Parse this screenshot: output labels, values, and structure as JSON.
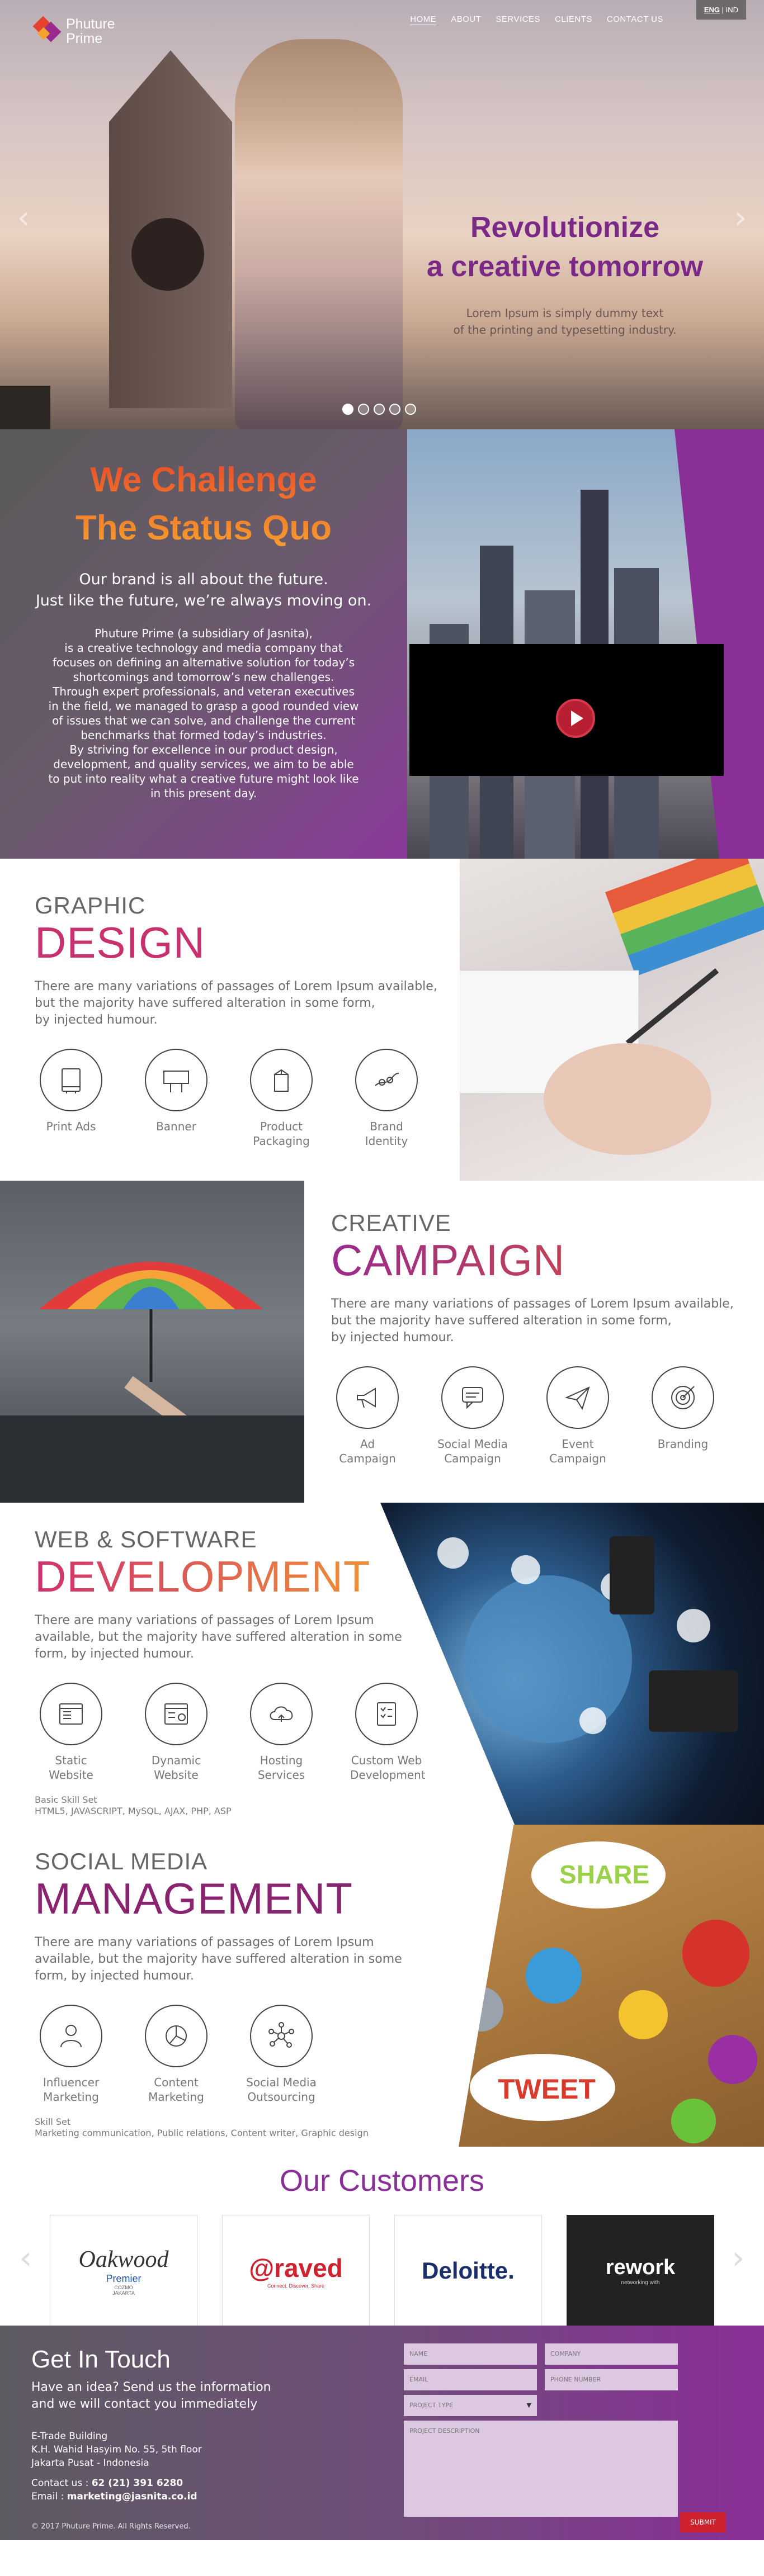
{
  "header": {
    "logo_line1": "Phuture",
    "logo_line2": "Prime",
    "nav": [
      {
        "label": "HOME"
      },
      {
        "label": "ABOUT"
      },
      {
        "label": "SERVICES"
      },
      {
        "label": "CLIENTS"
      },
      {
        "label": "CONTACT US"
      }
    ],
    "lang_active": "ENG",
    "lang_sep": " | ",
    "lang_other": "IND"
  },
  "hero": {
    "title_line1": "Revolutionize",
    "title_line2": "a creative tomorrow",
    "subtitle_line1": "Lorem Ipsum is simply dummy text",
    "subtitle_line2": "of the printing and typesetting industry.",
    "slides": 5,
    "active_slide": 1,
    "title_color": "#7a2a86"
  },
  "challenge": {
    "title_line1": "We Challenge",
    "title_line2": "The Status Quo",
    "lead_line1": "Our brand is all about the future.",
    "lead_line2": "Just like the future, we’re always moving on.",
    "body": [
      "Phuture Prime (a subsidiary of Jasnita),",
      "is a creative technology and media company that",
      "focuses on defining an alternative solution for today’s",
      "shortcomings and tomorrow’s new challenges.",
      "Through expert professionals, and veteran executives",
      "in the field, we managed to grasp a good rounded view",
      "of issues that we can solve, and challenge the current",
      "benchmarks that formed today’s industries.",
      "By striving for excellence in our product design,",
      "development, and quality services, we aim to be able",
      "to put into reality what a creative future might look like",
      "in this present day."
    ]
  },
  "graphic": {
    "title1": "GRAPHIC",
    "title2": "DESIGN",
    "color": "#c8306e",
    "desc_line1": "There are many variations of passages of Lorem Ipsum available,",
    "desc_line2": "but the majority have suffered alteration in some form,",
    "desc_line3": "by injected humour.",
    "items": [
      {
        "label": "Print Ads",
        "icon": "print-ads-icon"
      },
      {
        "label": "Banner",
        "icon": "banner-icon"
      },
      {
        "label": "Product Packaging",
        "icon": "packaging-icon"
      },
      {
        "label": "Brand Identity",
        "icon": "brand-identity-icon"
      }
    ]
  },
  "campaign": {
    "title1": "CREATIVE",
    "title2": "CAMPAIGN",
    "color": "#9a2a8c",
    "desc_line1": "There are many variations of passages of Lorem Ipsum available,",
    "desc_line2": "but the majority have suffered alteration in some form,",
    "desc_line3": "by injected humour.",
    "items": [
      {
        "label": "Ad Campaign",
        "icon": "megaphone-icon"
      },
      {
        "label": "Social Media Campaign",
        "icon": "chat-icon"
      },
      {
        "label": "Event Campaign",
        "icon": "paper-plane-icon"
      },
      {
        "label": "Branding",
        "icon": "target-icon"
      }
    ]
  },
  "dev": {
    "title1": "WEB & SOFTWARE",
    "title2": "DEVELOPMENT",
    "desc_line1": "There are many variations of passages of Lorem Ipsum",
    "desc_line2": "available, but the majority have suffered alteration in some",
    "desc_line3": "form, by injected humour.",
    "items": [
      {
        "label": "Static Website",
        "icon": "static-website-icon"
      },
      {
        "label": "Dynamic Website",
        "icon": "dynamic-website-icon"
      },
      {
        "label": "Hosting Services",
        "icon": "cloud-icon"
      },
      {
        "label": "Custom Web Development",
        "icon": "checklist-icon"
      }
    ],
    "skill_title": "Basic Skill Set",
    "skill_list": "HTML5, JAVASCRIPT, MySQL, AJAX, PHP, ASP"
  },
  "social": {
    "title1": "SOCIAL MEDIA",
    "title2": "MANAGEMENT",
    "color": "#8a2470",
    "desc_line1": "There are many variations of passages of Lorem Ipsum",
    "desc_line2": "available, but the majority have suffered alteration in some",
    "desc_line3": "form, by injected humour.",
    "items": [
      {
        "label": "Influencer Marketing",
        "icon": "person-icon"
      },
      {
        "label": "Content Marketing",
        "icon": "pie-chart-icon"
      },
      {
        "label": "Social Media Outsourcing",
        "icon": "network-icon"
      }
    ],
    "skill_title": "Skill Set",
    "skill_list": "Marketing communication, Public relations, Content writer, Graphic design",
    "photo_words": [
      "SHARE",
      "TWEET"
    ]
  },
  "customers": {
    "title": "Our Customers",
    "logos": [
      {
        "name": "Oakwood",
        "sub": "Premier",
        "sub2": "COZMO",
        "sub3": "JAKARTA"
      },
      {
        "name": "@raved",
        "sub": "Connect. Discover. Share"
      },
      {
        "name": "Deloitte."
      },
      {
        "name": "rework",
        "sub": "networking with"
      }
    ]
  },
  "contact": {
    "title": "Get In Touch",
    "sub_line1": "Have an idea? Send us the information",
    "sub_line2": "and we will contact you immediately",
    "addr_line1": "E-Trade Building",
    "addr_line2": "K.H. Wahid Hasyim No. 55, 5th floor",
    "addr_line3": "Jakarta Pusat - Indonesia",
    "phone_label": "Contact us : ",
    "phone": "62 (21) 391 6280",
    "email_label": "Email : ",
    "email": "marketing@jasnita.co.id",
    "copyright": "© 2017 Phuture Prime. All Rights Reserved.",
    "fields": {
      "name": "NAME",
      "company": "COMPANY",
      "email": "EMAIL",
      "phone": "PHONE NUMBER",
      "project_type": "PROJECT TYPE",
      "description": "PROJECT DESCRIPTION"
    },
    "submit": "SUBMIT"
  }
}
